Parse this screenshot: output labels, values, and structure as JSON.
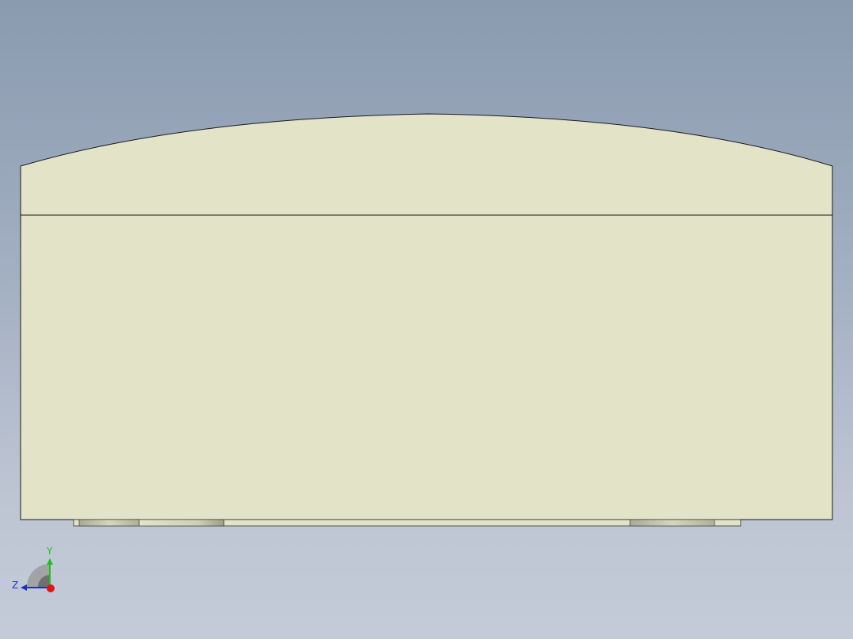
{
  "viewport": {
    "background_top": "#8a9aaf",
    "background_bottom": "#c4cbd8",
    "model_face_color": "#e3e3c8",
    "model_edge_color": "#1a1a1a",
    "foot_color": "#d8d8c0"
  },
  "triad": {
    "y_label": "Y",
    "z_label": "Z",
    "y_color": "#19c419",
    "z_color": "#1a2fd6",
    "x_color": "#e01414"
  }
}
